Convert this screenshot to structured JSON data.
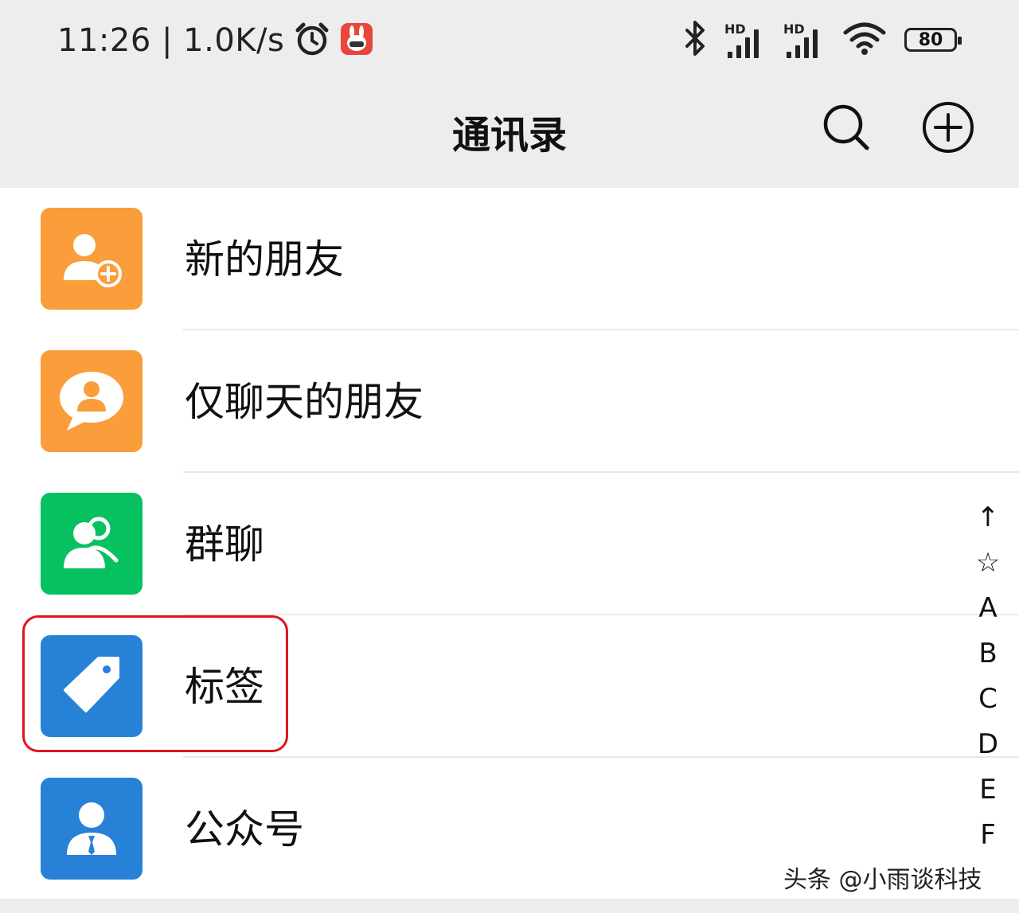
{
  "status": {
    "time_speed": "11:26 | 1.0K/s",
    "sim1": "HD",
    "sim2": "HD",
    "battery": "80"
  },
  "header": {
    "title": "通讯录"
  },
  "items": [
    {
      "label": "新的朋友",
      "color": "#fa9d3b"
    },
    {
      "label": "仅聊天的朋友",
      "color": "#fa9d3b"
    },
    {
      "label": "群聊",
      "color": "#07c160"
    },
    {
      "label": "标签",
      "color": "#2782d7"
    },
    {
      "label": "公众号",
      "color": "#2782d7"
    }
  ],
  "index": [
    "↑",
    "☆",
    "A",
    "B",
    "C",
    "D",
    "E",
    "F"
  ],
  "watermark": "头条 @小雨谈科技"
}
